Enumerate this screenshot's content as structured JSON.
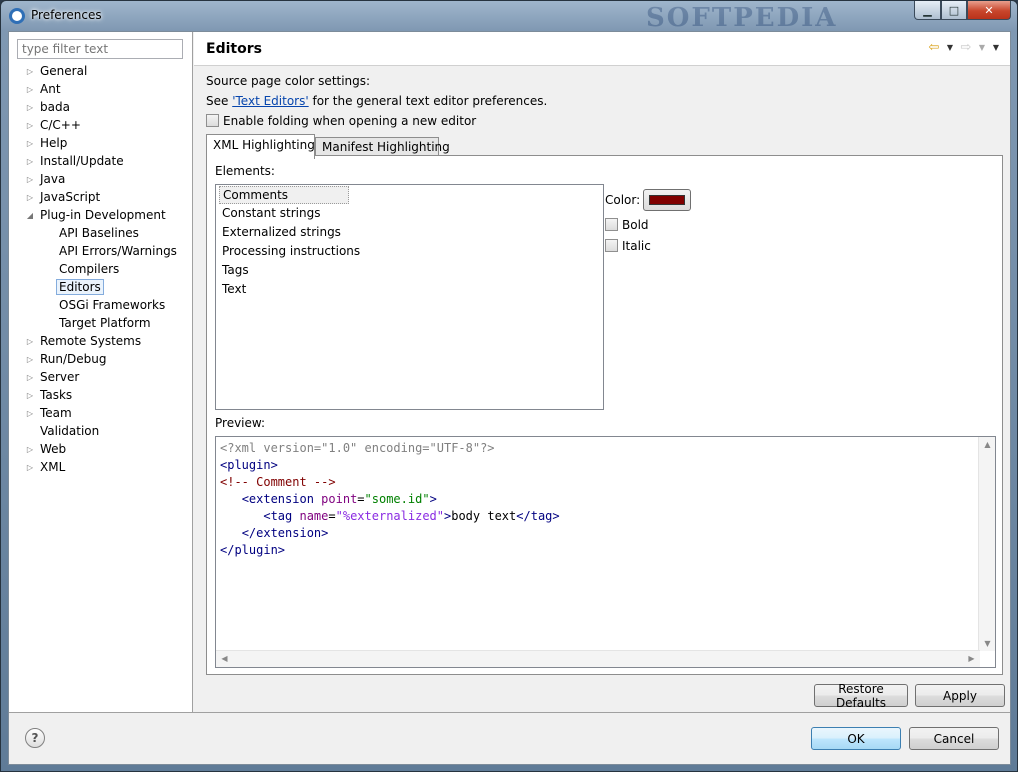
{
  "window": {
    "title": "Preferences",
    "watermark": "SOFTPEDIA",
    "controls": {
      "minimize": "▁",
      "maximize": "□",
      "close": "✕"
    }
  },
  "filter": {
    "placeholder": "type filter text"
  },
  "tree": {
    "items": [
      {
        "label": "General",
        "expanded": false
      },
      {
        "label": "Ant",
        "expanded": false
      },
      {
        "label": "bada",
        "expanded": false
      },
      {
        "label": "C/C++",
        "expanded": false
      },
      {
        "label": "Help",
        "expanded": false
      },
      {
        "label": "Install/Update",
        "expanded": false
      },
      {
        "label": "Java",
        "expanded": false
      },
      {
        "label": "JavaScript",
        "expanded": false
      },
      {
        "label": "Plug-in Development",
        "expanded": true
      },
      {
        "label": "API Baselines",
        "child": true
      },
      {
        "label": "API Errors/Warnings",
        "child": true
      },
      {
        "label": "Compilers",
        "child": true
      },
      {
        "label": "Editors",
        "child": true,
        "selected": true
      },
      {
        "label": "OSGi Frameworks",
        "child": true
      },
      {
        "label": "Target Platform",
        "child": true
      },
      {
        "label": "Remote Systems",
        "expanded": false
      },
      {
        "label": "Run/Debug",
        "expanded": false
      },
      {
        "label": "Server",
        "expanded": false
      },
      {
        "label": "Tasks",
        "expanded": false
      },
      {
        "label": "Team",
        "expanded": false
      },
      {
        "label": "Validation",
        "leaf": true
      },
      {
        "label": "Web",
        "expanded": false
      },
      {
        "label": "XML",
        "expanded": false
      }
    ]
  },
  "page": {
    "title": "Editors",
    "source_settings": "Source page color settings:",
    "see_prefix": "See ",
    "see_link": "'Text Editors'",
    "see_suffix": " for the general text editor preferences.",
    "folding_label": "Enable folding when opening a new editor",
    "tabs": [
      "XML Highlighting",
      "Manifest Highlighting"
    ],
    "elements_label": "Elements:",
    "elements": [
      "Comments",
      "Constant strings",
      "Externalized strings",
      "Processing instructions",
      "Tags",
      "Text"
    ],
    "color_label": "Color:",
    "color_value": "#800000",
    "bold_label": "Bold",
    "italic_label": "Italic",
    "preview_label": "Preview:"
  },
  "preview": {
    "lines": [
      [
        {
          "t": "<?xml version=\"1.0\" encoding=\"UTF-8\"?>",
          "c": "#808080"
        }
      ],
      [
        {
          "t": "<plugin>",
          "c": "#000080"
        }
      ],
      [
        {
          "t": "<!-- Comment -->",
          "c": "#800000"
        }
      ],
      [
        {
          "t": "   ",
          "c": "#000"
        },
        {
          "t": "<extension ",
          "c": "#000080"
        },
        {
          "t": "point",
          "c": "#7f007f"
        },
        {
          "t": "=",
          "c": "#000"
        },
        {
          "t": "\"some.id\"",
          "c": "#008000"
        },
        {
          "t": ">",
          "c": "#000080"
        }
      ],
      [
        {
          "t": "      ",
          "c": "#000"
        },
        {
          "t": "<tag ",
          "c": "#000080"
        },
        {
          "t": "name",
          "c": "#7f007f"
        },
        {
          "t": "=",
          "c": "#000"
        },
        {
          "t": "\"%externalized\"",
          "c": "#8a2be2"
        },
        {
          "t": ">",
          "c": "#000080"
        },
        {
          "t": "body text",
          "c": "#000"
        },
        {
          "t": "</tag>",
          "c": "#000080"
        }
      ],
      [
        {
          "t": "   ",
          "c": "#000"
        },
        {
          "t": "</extension>",
          "c": "#000080"
        }
      ],
      [
        {
          "t": "</plugin>",
          "c": "#000080"
        }
      ]
    ]
  },
  "buttons": {
    "restore_defaults": "Restore Defaults",
    "apply": "Apply",
    "ok": "OK",
    "cancel": "Cancel",
    "help": "?"
  },
  "colors": {
    "accent": "#3c7fb1",
    "selection": "#84acdd"
  }
}
